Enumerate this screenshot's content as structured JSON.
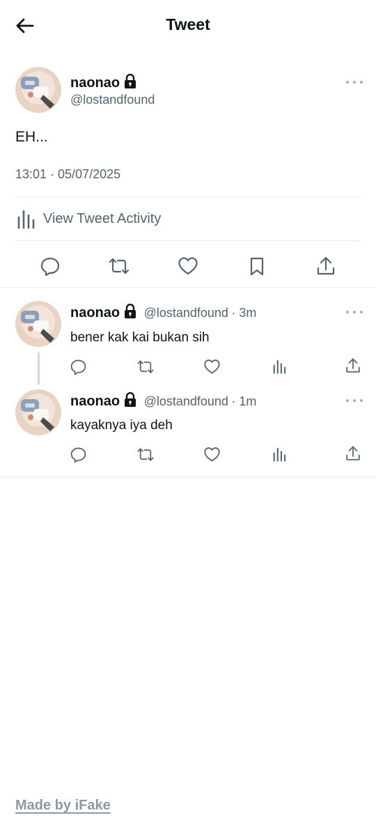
{
  "header": {
    "title": "Tweet",
    "back_icon": "arrow-left-icon"
  },
  "tweet": {
    "author_name": "naonao",
    "author_handle": "@lostandfound",
    "text": "EH...",
    "timestamp": "13:01 · 05/07/2025",
    "activity_label": "View Tweet Activity",
    "actions": [
      "reply-icon",
      "retweet-icon",
      "like-icon",
      "bookmark-icon",
      "share-icon"
    ]
  },
  "replies": [
    {
      "author_name": "naonao",
      "author_handle": "@lostandfound",
      "time": "· 3m",
      "text": "bener kak kai bukan sih"
    },
    {
      "author_name": "naonao",
      "author_handle": "@lostandfound",
      "time": "· 1m",
      "text": "kayaknya iya deh"
    }
  ],
  "footer": {
    "link_text": "Made by iFake"
  },
  "colors": {
    "text": "#0f1419",
    "secondary": "#536471",
    "divider": "#e6ecf0",
    "thread_line": "#cfd9de",
    "icon": "#536471"
  }
}
